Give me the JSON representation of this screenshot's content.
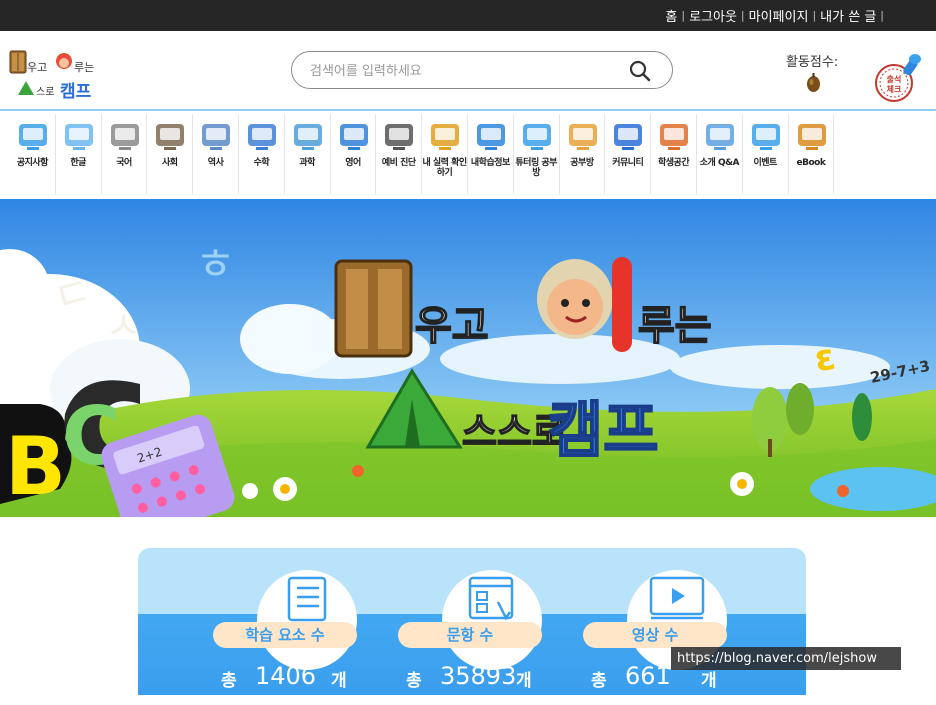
{
  "topnav": {
    "items": [
      "홈",
      "로그아웃",
      "마이페이지",
      "내가 쓴 글"
    ],
    "separator": "|"
  },
  "header": {
    "logo_text_line1": "배우고 이루는",
    "logo_text_line2": "스스로 캠프",
    "search_placeholder": "검색어를 입력하세요",
    "search_icon": "search-icon",
    "score_label": "활동점수:",
    "stamp_text_line1": "출석",
    "stamp_text_line2": "체크"
  },
  "menu": {
    "items": [
      {
        "label": "공지사항",
        "icon": "notice-monitor-icon"
      },
      {
        "label": "한글",
        "icon": "hangul-icon"
      },
      {
        "label": "국어",
        "icon": "books-icon"
      },
      {
        "label": "사회",
        "icon": "landmarks-icon"
      },
      {
        "label": "역사",
        "icon": "historical-figure-icon"
      },
      {
        "label": "수학",
        "icon": "pi-icon"
      },
      {
        "label": "과학",
        "icon": "microscope-icon"
      },
      {
        "label": "영어",
        "icon": "abc-icon"
      },
      {
        "label": "예비 진단",
        "icon": "diagnosis-icon"
      },
      {
        "label": "내 실력 확인하기",
        "icon": "test-check-icon"
      },
      {
        "label": "내학습정보",
        "icon": "learning-info-icon"
      },
      {
        "label": "튜터링 공부방",
        "icon": "tutoring-icon"
      },
      {
        "label": "공부방",
        "icon": "study-room-icon"
      },
      {
        "label": "커뮤니티",
        "icon": "megaphone-icon"
      },
      {
        "label": "학생공간",
        "icon": "store-icon"
      },
      {
        "label": "소개 Q&A",
        "icon": "intro-qa-icon"
      },
      {
        "label": "이벤트",
        "icon": "gift-icon"
      },
      {
        "label": "eBook",
        "icon": "ebook-icon"
      }
    ]
  },
  "banner": {
    "title_line1_big": "배",
    "title_line1_a": "우고",
    "title_line1_big2": "이",
    "title_line1_b": "루는",
    "title_line2_a": "스스로",
    "title_line2_big": "캠프",
    "side_text": "29-7+3"
  },
  "stats": [
    {
      "label": "학습 요소 수",
      "prefix": "총",
      "value": "1406",
      "suffix": "개",
      "icon": "checklist-icon"
    },
    {
      "label": "문항 수",
      "prefix": "총",
      "value": "35893",
      "suffix": "개",
      "icon": "quiz-form-icon"
    },
    {
      "label": "영상 수",
      "prefix": "총",
      "value": "661",
      "suffix": "개",
      "icon": "video-player-icon"
    }
  ],
  "watermark": "https://blog.naver.com/lejshow",
  "colors": {
    "topbar": "#262626",
    "header_border": "#8fd0f0",
    "sky": "#3d96ea",
    "grass": "#8ccc2e",
    "stats_top": "#b8e3fb",
    "stats_bottom": "#43a8f2",
    "pill": "#ffe6c8"
  }
}
